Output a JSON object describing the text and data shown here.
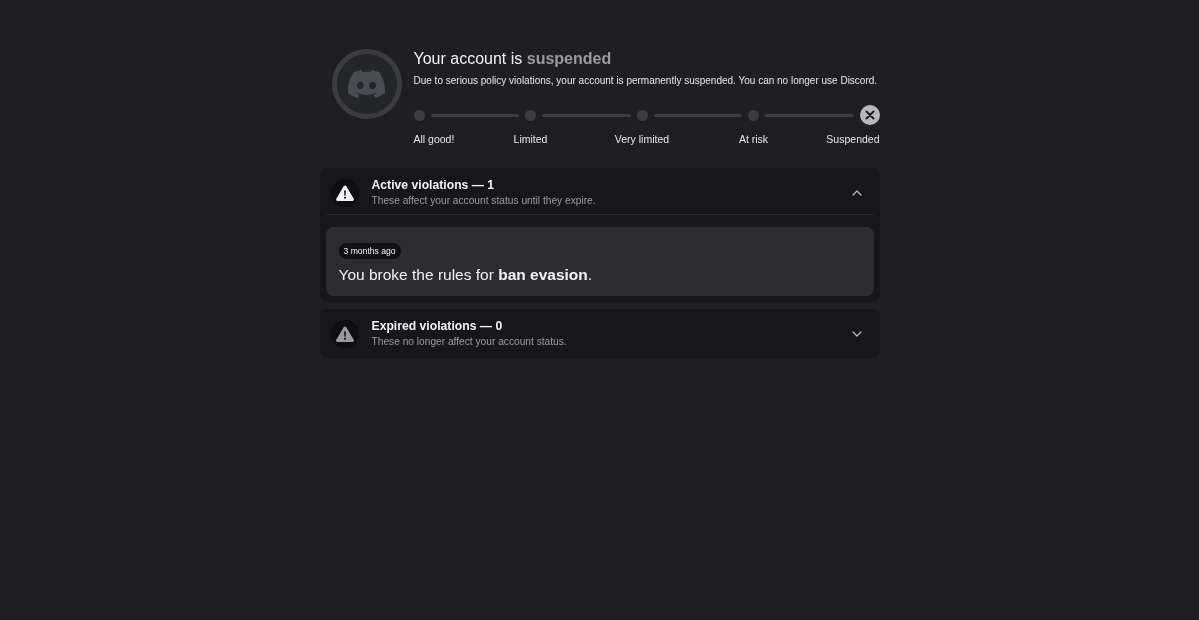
{
  "header": {
    "title": "Your account is **suspended**",
    "description": "Due to serious policy violations, your account is permanently suspended. You can no longer use Discord."
  },
  "status_steps": [
    {
      "label": "All good!",
      "selected": false
    },
    {
      "label": "Limited",
      "selected": false
    },
    {
      "label": "Very limited",
      "selected": false
    },
    {
      "label": "At risk",
      "selected": false
    },
    {
      "label": "Suspended",
      "selected": true
    }
  ],
  "sections": [
    {
      "kind": "active",
      "title": "Active violations — 1",
      "subtitle": "These affect your account status until they expire.",
      "expanded": true,
      "violations": [
        {
          "time": "3 months ago",
          "text": "You broke the rules for **ban evasion**."
        }
      ]
    },
    {
      "kind": "expired",
      "title": "Expired violations — 0",
      "subtitle": "These no longer affect your account status.",
      "expanded": false
    }
  ]
}
